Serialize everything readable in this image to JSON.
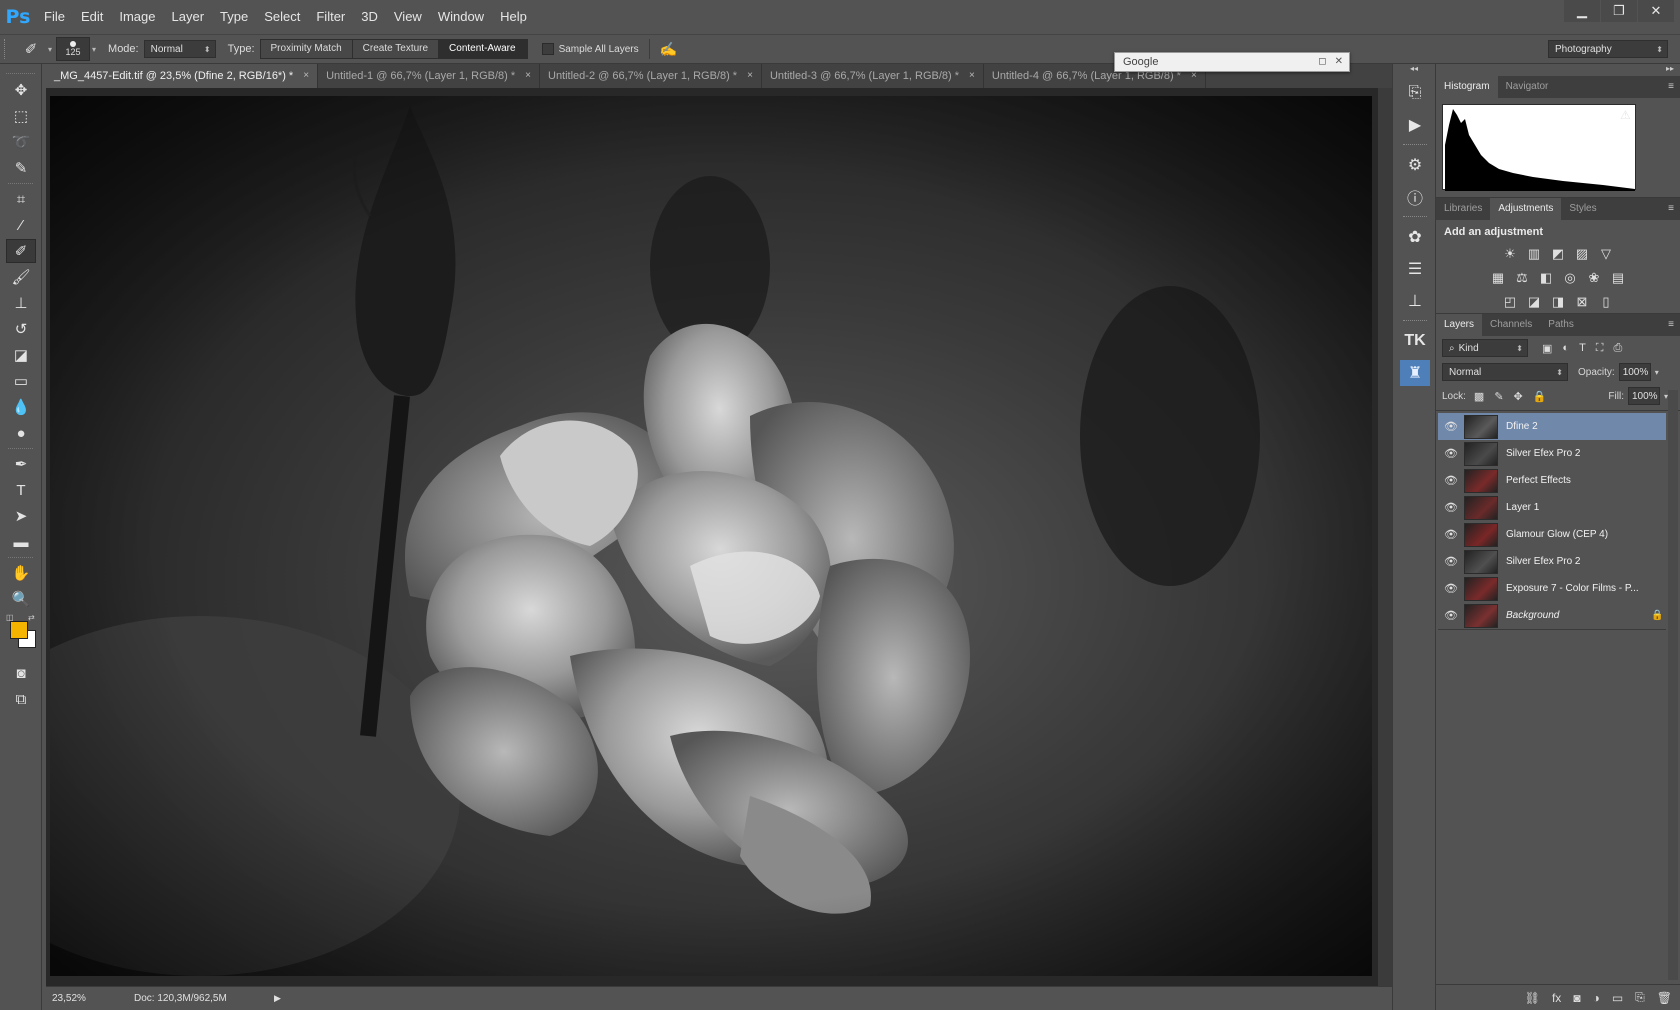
{
  "app": {
    "logo": "Ps"
  },
  "menu": [
    "File",
    "Edit",
    "Image",
    "Layer",
    "Type",
    "Select",
    "Filter",
    "3D",
    "View",
    "Window",
    "Help"
  ],
  "window_controls": {
    "minimize": "▁",
    "restore": "❐",
    "close": "✕"
  },
  "options": {
    "brush_size": "125",
    "mode_label": "Mode:",
    "mode_value": "Normal",
    "type_label": "Type:",
    "type_options": [
      "Proximity Match",
      "Create Texture",
      "Content-Aware"
    ],
    "type_selected": 2,
    "sample_all_label": "Sample All Layers",
    "workspace": "Photography"
  },
  "google_panel": {
    "title": "Google"
  },
  "tabs": [
    {
      "label": "_MG_4457-Edit.tif @ 23,5% (Dfine 2, RGB/16*) *",
      "active": true
    },
    {
      "label": "Untitled-1 @ 66,7% (Layer 1, RGB/8) *",
      "active": false
    },
    {
      "label": "Untitled-2 @ 66,7% (Layer 1, RGB/8) *",
      "active": false
    },
    {
      "label": "Untitled-3 @ 66,7% (Layer 1, RGB/8) *",
      "active": false
    },
    {
      "label": "Untitled-4 @ 66,7% (Layer 1, RGB/8) *",
      "active": false
    }
  ],
  "tab_close": "×",
  "status": {
    "zoom": "23,52%",
    "doc": "Doc: 120,3M/962,5M"
  },
  "tools": [
    {
      "name": "move-tool-icon",
      "glyph": "✥"
    },
    {
      "name": "marquee-tool-icon",
      "glyph": "⬚"
    },
    {
      "name": "lasso-tool-icon",
      "glyph": "➰"
    },
    {
      "name": "quick-select-tool-icon",
      "glyph": "✎"
    },
    {
      "name": "crop-tool-icon",
      "glyph": "⌗"
    },
    {
      "name": "eyedropper-tool-icon",
      "glyph": "⁄"
    },
    {
      "name": "healing-brush-tool-icon",
      "glyph": "✐",
      "active": true
    },
    {
      "name": "brush-tool-icon",
      "glyph": "🖌"
    },
    {
      "name": "stamp-tool-icon",
      "glyph": "⊥"
    },
    {
      "name": "history-brush-tool-icon",
      "glyph": "↺"
    },
    {
      "name": "eraser-tool-icon",
      "glyph": "◪"
    },
    {
      "name": "gradient-tool-icon",
      "glyph": "▭"
    },
    {
      "name": "blur-tool-icon",
      "glyph": "💧"
    },
    {
      "name": "dodge-tool-icon",
      "glyph": "●"
    },
    {
      "name": "pen-tool-icon",
      "glyph": "✒"
    },
    {
      "name": "type-tool-icon",
      "glyph": "T"
    },
    {
      "name": "path-select-tool-icon",
      "glyph": "➤"
    },
    {
      "name": "shape-tool-icon",
      "glyph": "▬"
    },
    {
      "name": "hand-tool-icon",
      "glyph": "✋"
    },
    {
      "name": "zoom-tool-icon",
      "glyph": "🔍"
    }
  ],
  "icon_column": [
    {
      "name": "history-icon",
      "glyph": "⎘"
    },
    {
      "name": "actions-play-icon",
      "glyph": "▶"
    },
    {
      "name": "properties-icon",
      "glyph": "⚙"
    },
    {
      "name": "info-icon",
      "glyph": "ⓘ"
    },
    {
      "name": "brush-presets-icon",
      "glyph": "✿"
    },
    {
      "name": "adjust-sliders-icon",
      "glyph": "☰"
    },
    {
      "name": "clone-source-icon",
      "glyph": "⊥"
    },
    {
      "name": "tk-panel-icon",
      "glyph": "TK"
    },
    {
      "name": "plugin-panel-icon",
      "glyph": "♜"
    }
  ],
  "histogram": {
    "tabs": [
      "Histogram",
      "Navigator"
    ],
    "warning": "⚠"
  },
  "adjustments": {
    "tabs": [
      "Libraries",
      "Adjustments",
      "Styles"
    ],
    "title": "Add an adjustment",
    "rows": [
      [
        "☀",
        "▥",
        "◩",
        "▨",
        "▽"
      ],
      [
        "▦",
        "⚖",
        "◧",
        "◎",
        "❀",
        "▤"
      ],
      [
        "◰",
        "◪",
        "◨",
        "⊠",
        "▯"
      ]
    ]
  },
  "layers": {
    "tabs": [
      "Layers",
      "Channels",
      "Paths"
    ],
    "kind_label": "Kind",
    "filter_icons": [
      "▣",
      "◐",
      "T",
      "⛶",
      "⎙"
    ],
    "blend_mode": "Normal",
    "opacity_label": "Opacity:",
    "opacity": "100%",
    "lock_label": "Lock:",
    "lock_icons": [
      "▩",
      "✎",
      "✥",
      "🔒"
    ],
    "fill_label": "Fill:",
    "fill": "100%",
    "items": [
      {
        "name": "Dfine 2",
        "selected": true,
        "thumb": "#5a5a5a"
      },
      {
        "name": "Silver Efex Pro 2",
        "selected": false,
        "thumb": "#4a4a4a"
      },
      {
        "name": "Perfect Effects",
        "selected": false,
        "thumb": "#7a2a2a"
      },
      {
        "name": "Layer 1",
        "selected": false,
        "thumb": "#6a2a2a"
      },
      {
        "name": "Glamour Glow (CEP 4)",
        "selected": false,
        "thumb": "#7a2626"
      },
      {
        "name": "Silver Efex Pro 2",
        "selected": false,
        "thumb": "#505050"
      },
      {
        "name": "Exposure 7 - Color Films - P...",
        "selected": false,
        "thumb": "#7a2a2a"
      },
      {
        "name": "Background",
        "selected": false,
        "thumb": "#7a3030",
        "locked": true
      }
    ],
    "footer_icons": [
      "⛓",
      "fx",
      "◙",
      "◑",
      "▭",
      "⎘",
      "🗑"
    ]
  }
}
